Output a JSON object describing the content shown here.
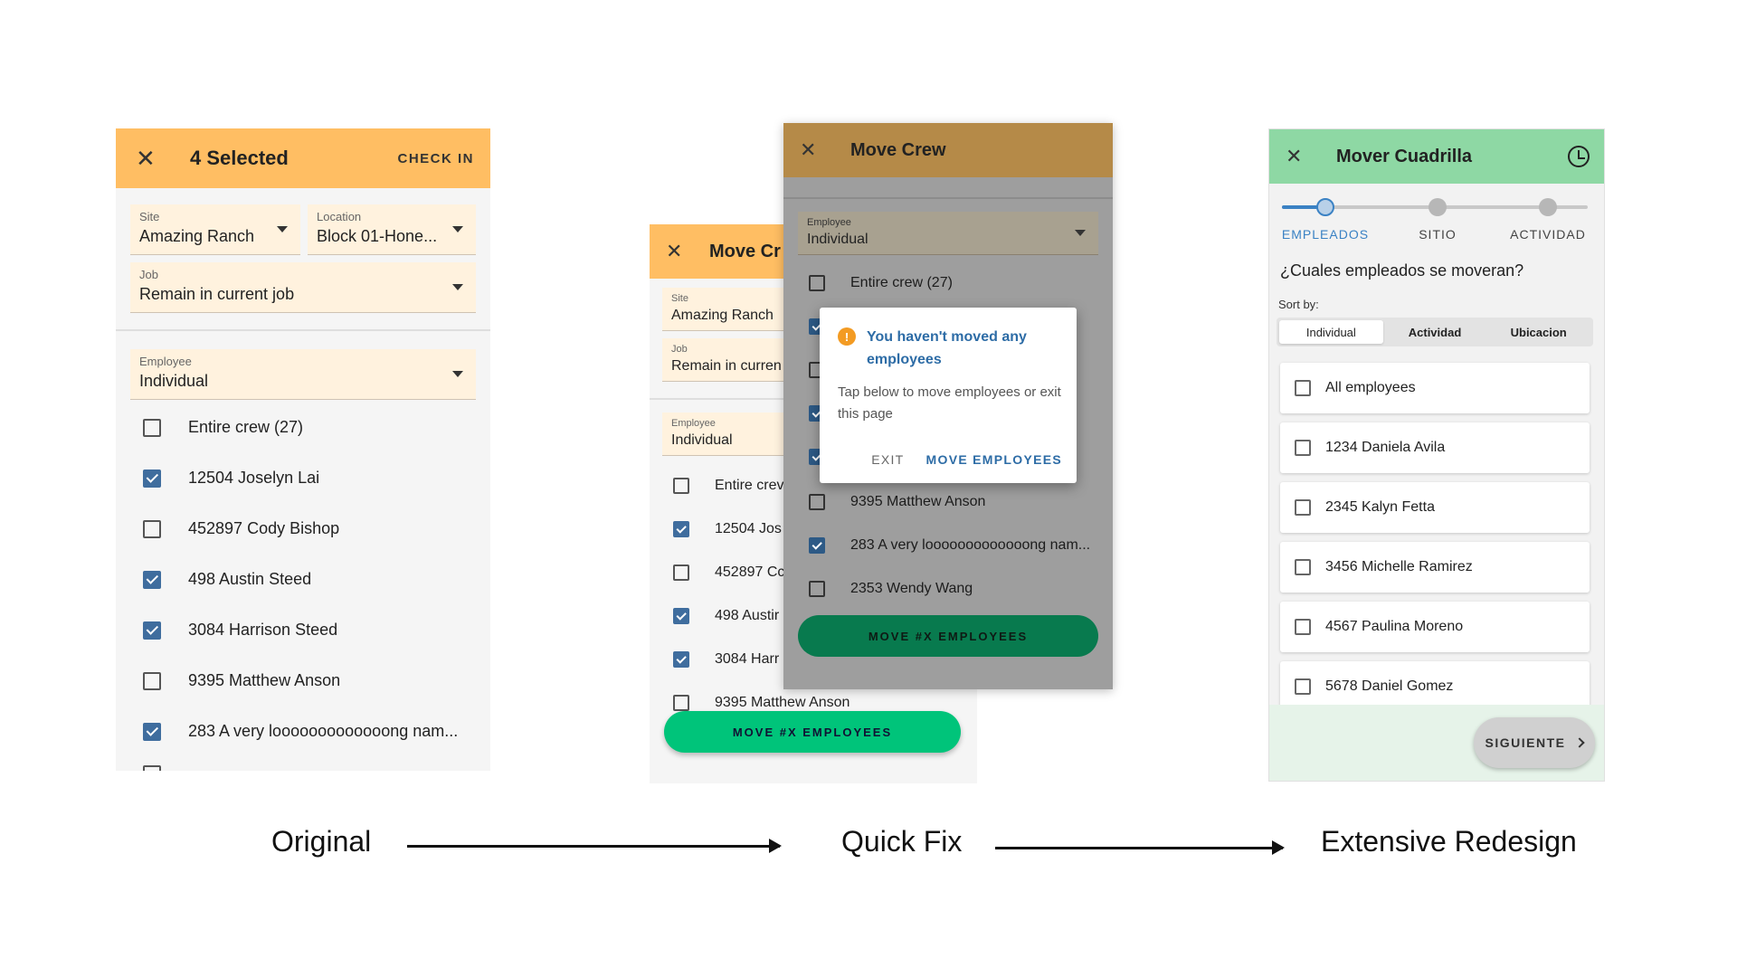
{
  "original": {
    "appbar": {
      "title": "4 Selected",
      "action": "CHECK IN"
    },
    "site": {
      "label": "Site",
      "value": "Amazing Ranch"
    },
    "location": {
      "label": "Location",
      "value": "Block 01-Hone..."
    },
    "job": {
      "label": "Job",
      "value": "Remain in current job"
    },
    "employee": {
      "label": "Employee",
      "value": "Individual"
    },
    "rows": [
      {
        "label": "Entire crew (27)",
        "checked": false
      },
      {
        "label": "12504 Joselyn Lai",
        "checked": true
      },
      {
        "label": "452897 Cody Bishop",
        "checked": false
      },
      {
        "label": "498 Austin Steed",
        "checked": true
      },
      {
        "label": "3084 Harrison Steed",
        "checked": true
      },
      {
        "label": "9395 Matthew Anson",
        "checked": false
      },
      {
        "label": "283 A very looooooooooooong nam...",
        "checked": true
      }
    ]
  },
  "quickfix_back": {
    "appbar": {
      "title": "Move Cr"
    },
    "site": {
      "label": "Site",
      "value": "Amazing Ranch"
    },
    "job": {
      "label": "Job",
      "value": "Remain in curren"
    },
    "employee": {
      "label": "Employee",
      "value": "Individual"
    },
    "rows": [
      {
        "label": "Entire crev",
        "checked": false
      },
      {
        "label": "12504 Jos",
        "checked": true
      },
      {
        "label": "452897 Cc",
        "checked": false
      },
      {
        "label": "498 Austir",
        "checked": true
      },
      {
        "label": "3084 Harr",
        "checked": true
      },
      {
        "label": "9395 Matthew Anson",
        "checked": false
      }
    ],
    "fab": "MOVE #X EMPLOYEES"
  },
  "quickfix_front": {
    "appbar": {
      "title": "Move Crew"
    },
    "employee": {
      "label": "Employee",
      "value": "Individual"
    },
    "rows": [
      {
        "label": "Entire crew (27)",
        "checked": false
      },
      {
        "label": "",
        "checked": true
      },
      {
        "label": "",
        "checked": false
      },
      {
        "label": "",
        "checked": true
      },
      {
        "label": "",
        "checked": true
      },
      {
        "label": "9395 Matthew Anson",
        "checked": false
      },
      {
        "label": "283 A very looooooooooooong nam...",
        "checked": true
      },
      {
        "label": "2353 Wendy Wang",
        "checked": false
      }
    ],
    "dialog": {
      "title": "You haven't moved any employees",
      "body": "Tap below to move employees or exit this page",
      "exit": "EXIT",
      "move": "MOVE EMPLOYEES"
    },
    "fab": "MOVE #X EMPLOYEES"
  },
  "redesign": {
    "appbar": {
      "title": "Mover Cuadrilla"
    },
    "steps": [
      "EMPLEADOS",
      "SITIO",
      "ACTIVIDAD"
    ],
    "active_step": 0,
    "question": "¿Cuales empleados se moveran?",
    "sort_label": "Sort by:",
    "sort_options": [
      "Individual",
      "Actividad",
      "Ubicacion"
    ],
    "employees": [
      "All employees",
      "1234 Daniela Avila",
      "2345 Kalyn Fetta",
      "3456 Michelle Ramirez",
      "4567 Paulina Moreno",
      "5678 Daniel Gomez"
    ],
    "next": "SIGUIENTE"
  },
  "captions": {
    "original": "Original",
    "quickfix": "Quick Fix",
    "redesign": "Extensive Redesign"
  },
  "colors": {
    "original_appbar": "#ffbe63",
    "quickfix_dim_appbar": "#b58a48",
    "redesign_appbar": "#8ed8a4",
    "checkbox_checked": "#3f6d9e",
    "fab_green": "#00c47a",
    "dialog_accent": "#2d6ca6",
    "warning": "#f39b23"
  }
}
